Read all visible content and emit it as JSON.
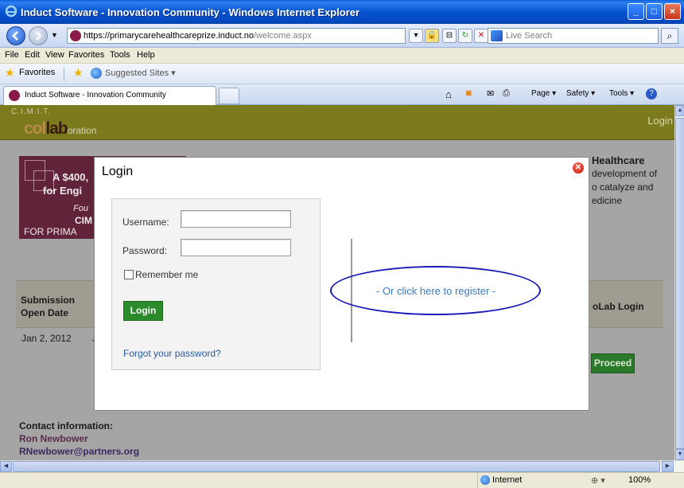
{
  "window": {
    "title": "Induct Software - Innovation Community - Windows Internet Explorer",
    "minimize": "_",
    "maximize": "□",
    "close": "×"
  },
  "address": {
    "url_main": "https://primarycarehealthcareprize.induct.no",
    "url_tail": "/welcome.aspx",
    "search_placeholder": "Live Search"
  },
  "menu": [
    "File",
    "Edit",
    "View",
    "Favorites",
    "Tools",
    "Help"
  ],
  "favorites_bar": {
    "favorites_label": "Favorites",
    "suggested_sites": "Suggested Sites ▾"
  },
  "tab": {
    "title": "Induct Software - Innovation Community"
  },
  "command_bar": {
    "page": "Page ▾",
    "safety": "Safety ▾",
    "tools": "Tools ▾"
  },
  "site": {
    "logo_top": "C.I.M.I.T.",
    "logo_col": "col",
    "logo_lab": "lab",
    "logo_oration": "oration",
    "login_link": "Login",
    "banner": {
      "line1": "A $400,",
      "line2": "for Engi",
      "line3": "Fou",
      "line4": "CIM",
      "line5": "FOR PRIMA"
    },
    "right_text": {
      "title": "Healthcare",
      "line1": "development of",
      "line2": "o catalyze and",
      "line3": "edicine"
    },
    "table": {
      "col_submission_line1": "Submission",
      "col_submission_line2": "Open Date",
      "col_login": "oLab Login",
      "row_date": "Jan 2, 2012",
      "row_j": "J",
      "proceed": "Proceed"
    },
    "contact": {
      "heading": "Contact information:",
      "name": "Ron Newbower",
      "email": "RNewbower@partners.org"
    }
  },
  "modal": {
    "title": "Login",
    "username_label": "Username:",
    "username_value": "",
    "password_label": "Password:",
    "password_value": "",
    "remember_label": "Remember me",
    "remember_checked": false,
    "login_button": "Login",
    "forgot_link": "Forgot your password?",
    "register_link": "- Or click here to register -"
  },
  "status": {
    "zone": "Internet",
    "zoom": "100%"
  },
  "colors": {
    "header_olive": "#7b7a1d",
    "banner_maroon": "#612339",
    "login_green": "#2b8a2b",
    "annotation_oval": "#1a1ab8"
  }
}
